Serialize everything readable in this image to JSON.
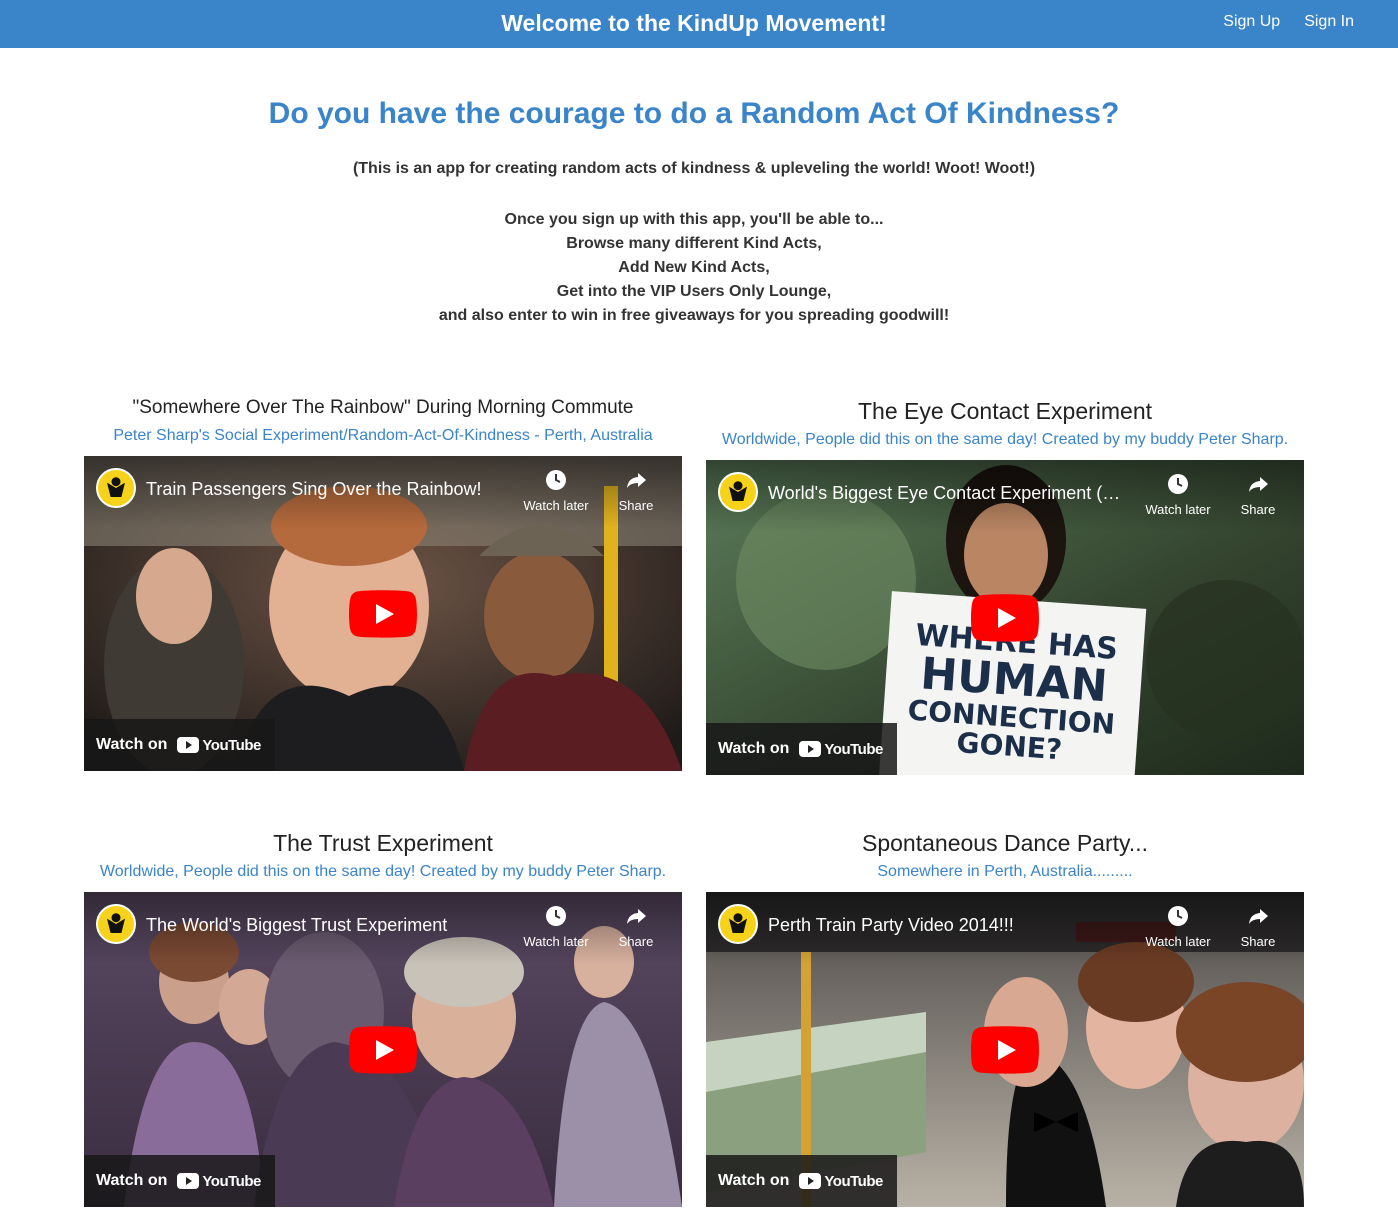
{
  "nav": {
    "brand": "Welcome to the KindUp Movement!",
    "sign_up": "Sign Up",
    "sign_in": "Sign In"
  },
  "hero": {
    "title": "Do you have the courage to do a Random Act Of Kindness?",
    "subtitle": "(This is an app for creating random acts of kindness & upleveling the world! Woot! Woot!)",
    "lines": [
      "Once you sign up with this app, you'll be able to...",
      "Browse many different Kind Acts,",
      "Add New Kind Acts,",
      "Get into the VIP Users Only Lounge,",
      "and also enter to win in free giveaways for you spreading goodwill!"
    ]
  },
  "videos": [
    {
      "title": "\"Somewhere Over The Rainbow\" During Morning Commute",
      "subtitle": "Peter Sharp's Social Experiment/Random-Act-Of-Kindness - Perth, Australia",
      "video_title": "Train Passengers Sing Over the Rainbow!",
      "watch_later": "Watch later",
      "share": "Share",
      "watch_on": "Watch on",
      "youtube": "YouTube"
    },
    {
      "title": "The Eye Contact Experiment",
      "subtitle": "Worldwide, People did this on the same day! Created by my buddy Peter Sharp.",
      "video_title": "World's Biggest Eye Contact Experiment (Gl...",
      "watch_later": "Watch later",
      "share": "Share",
      "watch_on": "Watch on",
      "youtube": "YouTube",
      "sign_text": [
        "WHERE HAS",
        "HUMAN",
        "CONNECTION",
        "GONE?"
      ]
    },
    {
      "title": "The Trust Experiment",
      "subtitle": "Worldwide, People did this on the same day! Created by my buddy Peter Sharp.",
      "video_title": "The World's Biggest Trust Experiment",
      "watch_later": "Watch later",
      "share": "Share",
      "watch_on": "Watch on",
      "youtube": "YouTube"
    },
    {
      "title": "Spontaneous Dance Party...",
      "subtitle": "Somewhere in Perth, Australia.........",
      "video_title": "Perth Train Party Video 2014!!!",
      "watch_later": "Watch later",
      "share": "Share",
      "watch_on": "Watch on",
      "youtube": "YouTube"
    }
  ],
  "colors": {
    "navbar": "#3a84c9",
    "accent": "#3a84c9",
    "play_button": "#ff0000"
  }
}
